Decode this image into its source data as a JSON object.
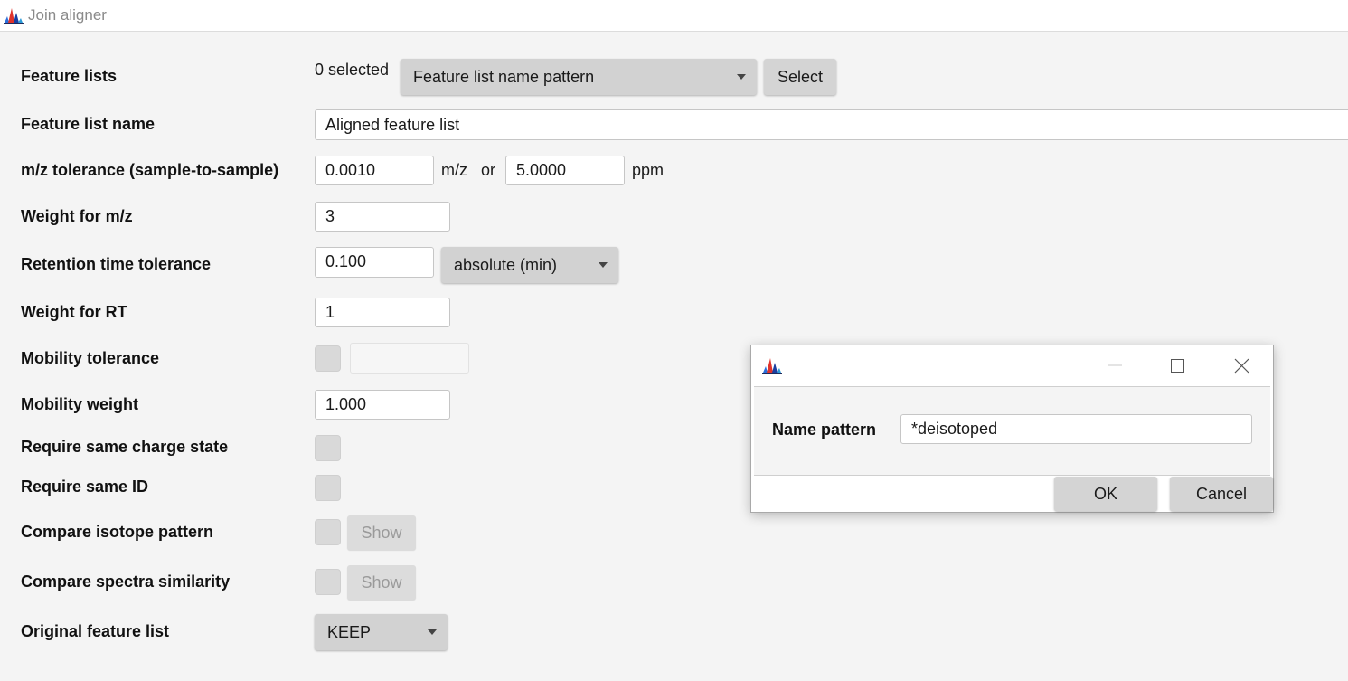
{
  "window": {
    "title": "Join aligner",
    "icon": "app-chart-icon"
  },
  "form": {
    "feature_lists": {
      "label": "Feature lists",
      "selected_text": "0 selected",
      "selector_value": "Feature list name pattern",
      "select_label": "Select"
    },
    "feature_list_name": {
      "label": "Feature list name",
      "value": "Aligned feature list"
    },
    "mz_tolerance": {
      "label": "m/z tolerance (sample-to-sample)",
      "mz_value": "0.0010",
      "mz_unit": "m/z",
      "or_text": "or",
      "ppm_value": "5.0000",
      "ppm_unit": "ppm"
    },
    "weight_mz": {
      "label": "Weight for m/z",
      "value": "3"
    },
    "rt_tolerance": {
      "label": "Retention time tolerance",
      "value": "0.100",
      "unit_value": "absolute (min)"
    },
    "weight_rt": {
      "label": "Weight for RT",
      "value": "1"
    },
    "mobility_tolerance": {
      "label": "Mobility tolerance",
      "checked": false,
      "value": ""
    },
    "mobility_weight": {
      "label": "Mobility weight",
      "value": "1.000"
    },
    "require_charge": {
      "label": "Require same charge state",
      "checked": false
    },
    "require_id": {
      "label": "Require same ID",
      "checked": false
    },
    "compare_isotope": {
      "label": "Compare isotope pattern",
      "checked": false,
      "show_label": "Show"
    },
    "compare_spectra": {
      "label": "Compare spectra similarity",
      "checked": false,
      "show_label": "Show"
    },
    "original_feature_list": {
      "label": "Original feature list",
      "value": "KEEP"
    }
  },
  "dialog": {
    "icon": "app-chart-icon",
    "minimize_icon": "minimize-icon",
    "maximize_icon": "maximize-icon",
    "close_icon": "close-icon",
    "name_pattern_label": "Name pattern",
    "name_pattern_value": "*deisotoped",
    "ok_label": "OK",
    "cancel_label": "Cancel"
  }
}
